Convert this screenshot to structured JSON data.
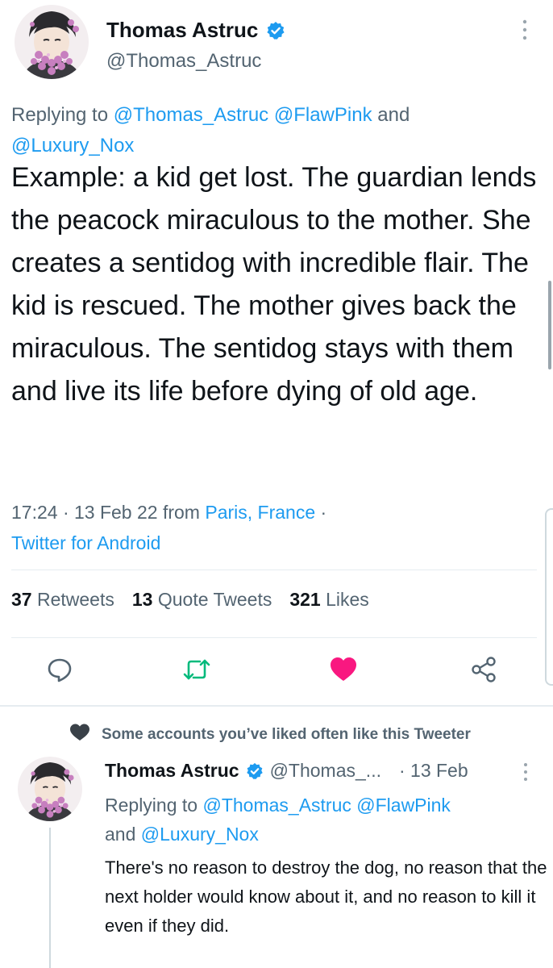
{
  "main_tweet": {
    "display_name": "Thomas Astruc",
    "handle": "@Thomas_Astruc",
    "replying_prefix": "Replying to ",
    "replying_to": [
      "@Thomas_Astruc",
      "@FlawPink"
    ],
    "replying_and": " and ",
    "replying_last": "@Luxury_Nox",
    "text": "Example: a kid get lost. The guardian lends the peacock miraculous to the mother. She creates a sentidog with incredible flair. The kid is rescued. The mother gives back the miraculous. The sentidog stays with them and live its life before dying of old age.",
    "time": "17:24 · 13 Feb 22 from ",
    "location": "Paris, France",
    "location_suffix": " ·",
    "client": "Twitter for Android",
    "stats": {
      "retweets_count": "37",
      "retweets_label": "Retweets",
      "quotes_count": "13",
      "quotes_label": "Quote Tweets",
      "likes_count": "321",
      "likes_label": "Likes"
    },
    "liked": true
  },
  "reply": {
    "social_context": "Some accounts you’ve liked often like this Tweeter",
    "display_name": "Thomas Astruc",
    "handle": "@Thomas_...",
    "date": "· 13 Feb",
    "replying_prefix": "Replying to ",
    "replying_to": [
      "@Thomas_Astruc",
      "@FlawPink"
    ],
    "replying_and": "and ",
    "replying_last": "@Luxury_Nox",
    "text": "There's no reason to destroy the dog, no reason that the next holder would know about it, and no reason to kill it even if they did."
  },
  "colors": {
    "link": "#1d9bf0",
    "muted": "#536471",
    "like": "#f91880",
    "retweet": "#00ba7c"
  },
  "icons": [
    "verified-badge-icon",
    "more-icon",
    "reply-icon",
    "retweet-icon",
    "like-icon",
    "share-icon",
    "heart-icon"
  ]
}
